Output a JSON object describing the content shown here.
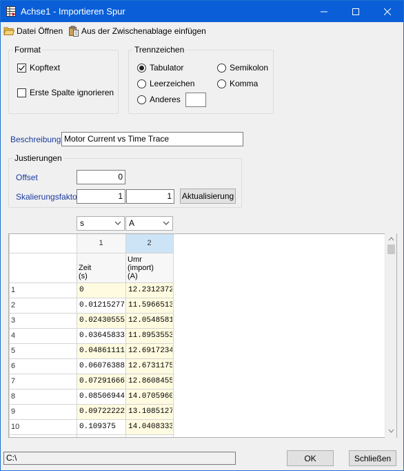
{
  "window": {
    "title": "Achse1 - Importieren Spur"
  },
  "toolbar": {
    "open_label": "Datei Öffnen",
    "paste_label": "Aus der Zwischenablage einfügen"
  },
  "format": {
    "legend": "Format",
    "header_label": "Kopftext",
    "header_checked": true,
    "ignore_first_label": "Erste Spalte ignorieren",
    "ignore_first_checked": false
  },
  "separator": {
    "legend": "Trennzeichen",
    "tab_label": "Tabulator",
    "semicolon_label": "Semikolon",
    "space_label": "Leerzeichen",
    "comma_label": "Komma",
    "other_label": "Anderes",
    "selected": "Tabulator",
    "other_value": ""
  },
  "description": {
    "label": "Beschreibung",
    "value": "Motor Current vs Time Trace"
  },
  "adjustments": {
    "legend": "Justierungen",
    "offset_label": "Offset",
    "offset_value": "0",
    "scale_label": "Skalierungsfaktor",
    "scale_value_1": "1",
    "scale_value_2": "1",
    "update_button": "Aktualisierung"
  },
  "units": {
    "col1": "s",
    "col2": "A"
  },
  "grid": {
    "col_numbers": [
      "1",
      "2"
    ],
    "col_headers": [
      "Zeit\n(s)",
      "Umr\n(import)\n(A)"
    ],
    "rows": [
      {
        "num": "1",
        "c1": "0",
        "c2": "12.2312372"
      },
      {
        "num": "2",
        "c1": "0.01215277",
        "c2": "11.5966513"
      },
      {
        "num": "3",
        "c1": "0.02430555",
        "c2": "12.0548581"
      },
      {
        "num": "4",
        "c1": "0.03645833",
        "c2": "11.8953553"
      },
      {
        "num": "5",
        "c1": "0.04861111",
        "c2": "12.6917234"
      },
      {
        "num": "6",
        "c1": "0.06076388",
        "c2": "12.6731175"
      },
      {
        "num": "7",
        "c1": "0.07291666",
        "c2": "12.8608455"
      },
      {
        "num": "8",
        "c1": "0.08506944",
        "c2": "14.0705960"
      },
      {
        "num": "9",
        "c1": "0.09722222",
        "c2": "13.1085127"
      },
      {
        "num": "10",
        "c1": "0.109375",
        "c2": "14.0408333"
      }
    ]
  },
  "status": {
    "path": "C:\\"
  },
  "buttons": {
    "ok": "OK",
    "close": "Schließen"
  },
  "colors": {
    "titlebar": "#0a5fd8",
    "label_blue": "#1a3aa0",
    "cell_highlight": "#fffbe0",
    "selected_header": "#cde4f7"
  }
}
